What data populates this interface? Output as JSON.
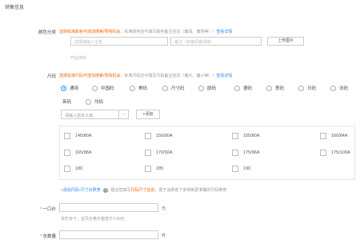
{
  "section_title": "销售信息",
  "color": {
    "label": "颜色分类",
    "hint_orange": "选择标准颜色可增加搜索/导购机会",
    "hint_grey": "，标准颜色还可填写颜色备注信息（偏深、偏亮等）！",
    "hint_link": "查看详情",
    "select_placeholder": "选择或输入主色",
    "remark_placeholder": "备注（如偏深偏浅等）",
    "upload_label": "上传图片",
    "start_sort": "开始排序"
  },
  "size": {
    "label": "尺码",
    "hint_orange": "选择标准尺码可增加搜索/导购机会",
    "hint_grey": "，标准尺码还可填写尺码备注信息（偏大、偏小等）！",
    "hint_link": "查看详情",
    "options": [
      "通用",
      "中国码",
      "美码",
      "尺寸码",
      "欧码",
      "德码",
      "意码",
      "日码",
      "法码",
      "英码",
      "均码"
    ],
    "selected": "通用",
    "custom_placeholder": "请输入自定义值",
    "add_label": "+添加",
    "values": [
      "145/80A",
      "150/80A",
      "155/80A",
      "160/84A",
      "165/88A",
      "170/92A",
      "175/96A",
      "175/100A",
      "180",
      "185",
      "190"
    ],
    "add_size_table": "+添加尺码-尺寸对照表",
    "tip_prefix": "建议您填写",
    "tip_highlight": "尺码尺寸信息",
    "tip_suffix": "，便于消费者下单得到更准确的尺码推荐"
  },
  "price": {
    "label": "一口价",
    "unit": "元",
    "note": "本栏目下，宝贝价格不能低于7.00元"
  },
  "stock": {
    "label": "总数量",
    "unit": "件"
  }
}
